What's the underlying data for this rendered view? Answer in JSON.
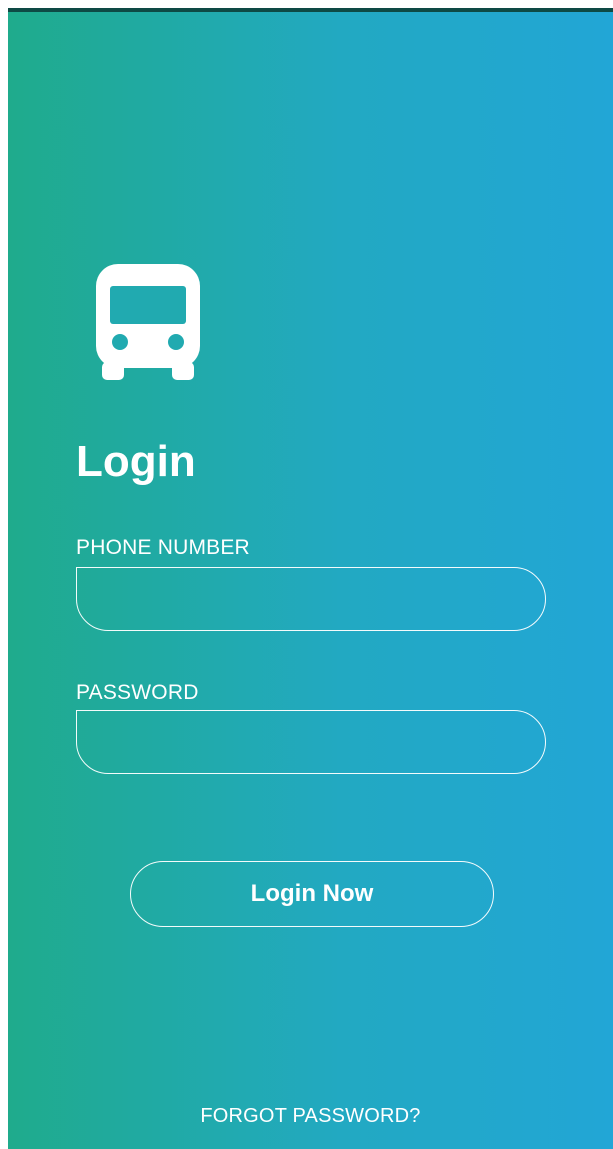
{
  "screen": {
    "title": "Login",
    "app_icon": "bus-icon"
  },
  "form": {
    "phone_label": "PHONE NUMBER",
    "phone_value": "",
    "password_label": "PASSWORD",
    "password_value": ""
  },
  "actions": {
    "login_label": "Login Now",
    "forgot_label": "FORGOT PASSWORD?"
  },
  "colors": {
    "gradient_start": "#1fab8c",
    "gradient_end": "#22a6d6",
    "text": "#ffffff",
    "status_bar": "#0e4a45"
  }
}
